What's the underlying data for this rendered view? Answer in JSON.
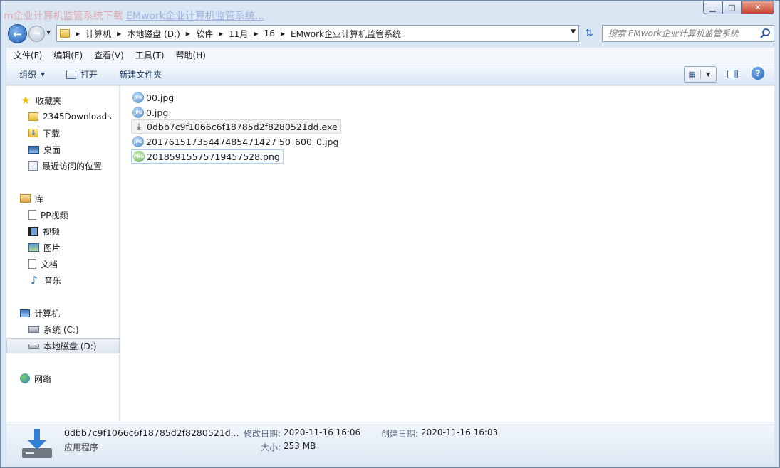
{
  "background_title": {
    "text": "m企业计算机监管系统下载",
    "link": "EMwork企业计算机监管系统..."
  },
  "window_controls": {
    "minimize": "▁",
    "maximize": "□",
    "close": "✕"
  },
  "address": {
    "crumbs": [
      "计算机",
      "本地磁盘 (D:)",
      "软件",
      "11月",
      "16",
      "EMwork企业计算机监管系统"
    ]
  },
  "search": {
    "placeholder": "搜索 EMwork企业计算机监管系统"
  },
  "menu": [
    "文件(F)",
    "编辑(E)",
    "查看(V)",
    "工具(T)",
    "帮助(H)"
  ],
  "toolbar": {
    "organize": "组织",
    "open": "打开",
    "new_folder": "新建文件夹"
  },
  "nav": {
    "favorites": "收藏夹",
    "fav_items": [
      "2345Downloads",
      "下载",
      "桌面",
      "最近访问的位置"
    ],
    "libraries": "库",
    "lib_items": [
      "PP视频",
      "视频",
      "图片",
      "文档",
      "音乐"
    ],
    "computer": "计算机",
    "comp_items": [
      "系统 (C:)",
      "本地磁盘 (D:)"
    ],
    "network": "网络"
  },
  "files": [
    {
      "name": "00.jpg",
      "type": "jpg"
    },
    {
      "name": "0.jpg",
      "type": "jpg"
    },
    {
      "name": "0dbb7c9f1066c6f18785d2f8280521dd.exe",
      "type": "exe"
    },
    {
      "name": "20176151735447485471427 50_600_0.jpg",
      "type": "jpg"
    },
    {
      "name": "20185915575719457528.png",
      "type": "png"
    }
  ],
  "details": {
    "name": "0dbb7c9f1066c6f18785d2f8280521d...",
    "type": "应用程序",
    "modified_label": "修改日期:",
    "modified_value": "2020-11-16 16:06",
    "size_label": "大小:",
    "size_value": "253 MB",
    "created_label": "创建日期:",
    "created_value": "2020-11-16 16:03"
  },
  "colors": {
    "accent": "#1f5fb4",
    "window_bg": "#dbe6f3"
  }
}
